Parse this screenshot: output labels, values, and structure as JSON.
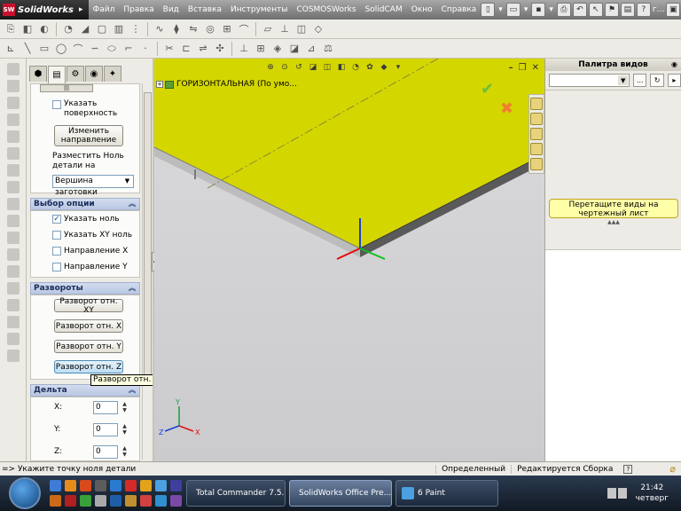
{
  "app": {
    "name": "SolidWorks",
    "menu": [
      "Файл",
      "Правка",
      "Вид",
      "Вставка",
      "Инструменты",
      "COSMOSWorks",
      "SolidCAM",
      "Окно",
      "Справка"
    ],
    "help_label": "г..."
  },
  "property_manager": {
    "show_surface_label": "Указать поверхность",
    "change_direction_label": "Изменить направление",
    "place_zero_label": "Разместить Ноль детали на",
    "place_zero_value": "Вершина заготовки",
    "options_header": "Выбор опции",
    "options": [
      {
        "label": "Указать ноль",
        "checked": true
      },
      {
        "label": "Указать XY ноль",
        "checked": false
      },
      {
        "label": "Направление  X",
        "checked": false
      },
      {
        "label": "Направление Y",
        "checked": false
      }
    ],
    "rotations_header": "Развороты",
    "rotations": [
      "Разворот отн. XY",
      "Разворот отн. X",
      "Разворот отн. Y",
      "Разворот отн. Z"
    ],
    "tooltip": "Разворот отн. Z",
    "delta_header": "Дельта",
    "delta": [
      {
        "label": "X:",
        "value": "0"
      },
      {
        "label": "Y:",
        "value": "0"
      },
      {
        "label": "Z:",
        "value": "0"
      }
    ]
  },
  "viewport": {
    "tree_node": "ГОРИЗОНТАЛЬНАЯ  (По умо...",
    "colors": {
      "plate_top": "#d4d600",
      "plate_side": "#c8c8c8",
      "background": "#d4d4d6"
    }
  },
  "palette": {
    "title": "Палитра видов",
    "hint": "Перетащите виды на чертежный лист"
  },
  "status": {
    "message": "=> Укажите точку ноля детали",
    "state": "Определенный",
    "mode": "Редактируется Сборка"
  },
  "taskbar": {
    "tasks": [
      "Total Commander 7.5...",
      "SolidWorks Office Pre...",
      "6 Paint"
    ],
    "time": "21:42",
    "day": "четверг"
  }
}
